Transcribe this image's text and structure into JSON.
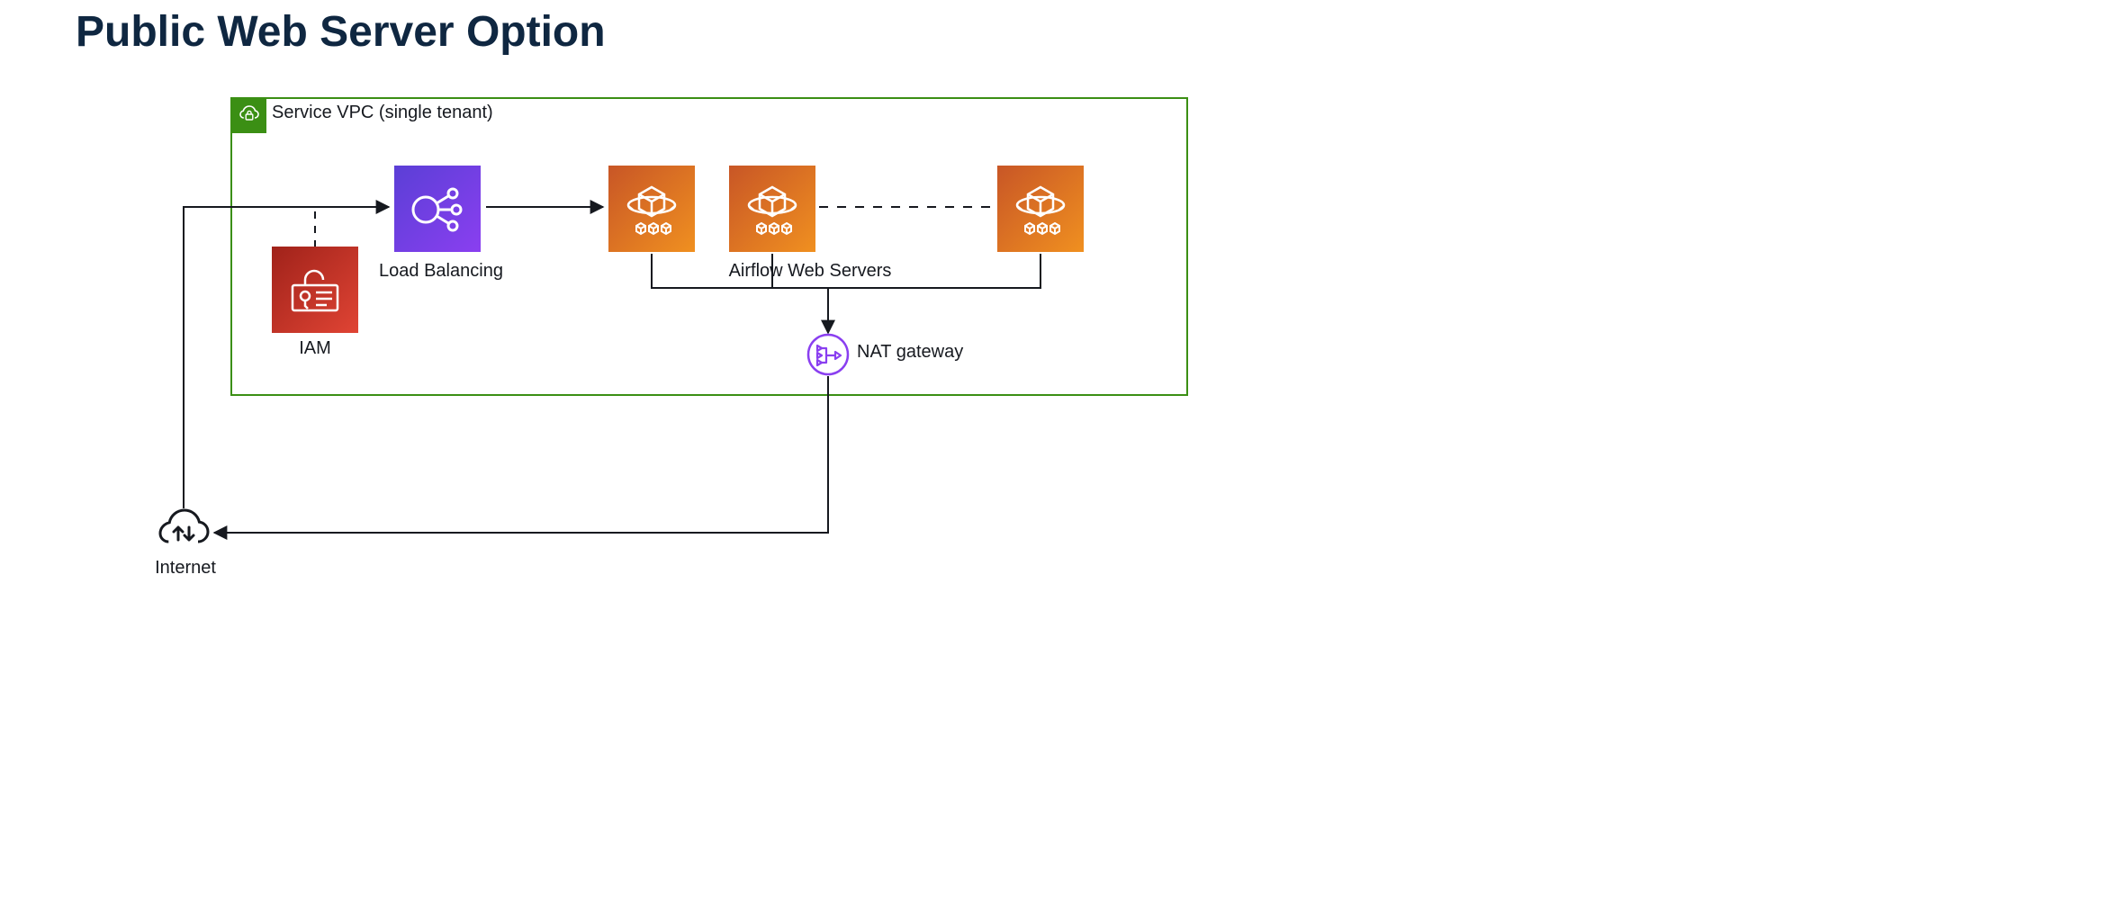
{
  "title": "Public Web Server Option",
  "vpc": {
    "label": "Service VPC (single tenant)"
  },
  "nodes": {
    "internet": {
      "label": "Internet"
    },
    "iam": {
      "label": "IAM"
    },
    "loadBalancing": {
      "label": "Load Balancing"
    },
    "webServers": {
      "label": "Airflow Web Servers"
    },
    "natGateway": {
      "label": "NAT gateway"
    }
  },
  "colors": {
    "heading": "#0f2741",
    "vpcBorder": "#3b8f14",
    "loadBalancerFrom": "#5b3fd6",
    "loadBalancerTo": "#8a3ff0",
    "containerFrom": "#c85626",
    "containerTo": "#f09020",
    "iamFrom": "#a0221a",
    "iamTo": "#e04434",
    "natStroke": "#8a3ff0",
    "arrow": "#16191f"
  },
  "diagram": {
    "edges": [
      {
        "from": "internet",
        "to": "loadBalancing",
        "style": "solid",
        "arrow": true
      },
      {
        "from": "iam",
        "to": "loadBalancing-path",
        "style": "dashed",
        "arrow": false
      },
      {
        "from": "loadBalancing",
        "to": "webServers",
        "style": "solid",
        "arrow": true
      },
      {
        "from": "webServers",
        "to": "webServers-more",
        "style": "dashed",
        "arrow": false
      },
      {
        "from": "webServers",
        "to": "natGateway",
        "style": "solid",
        "arrow": true
      },
      {
        "from": "natGateway",
        "to": "internet",
        "style": "solid",
        "arrow": true
      }
    ]
  }
}
